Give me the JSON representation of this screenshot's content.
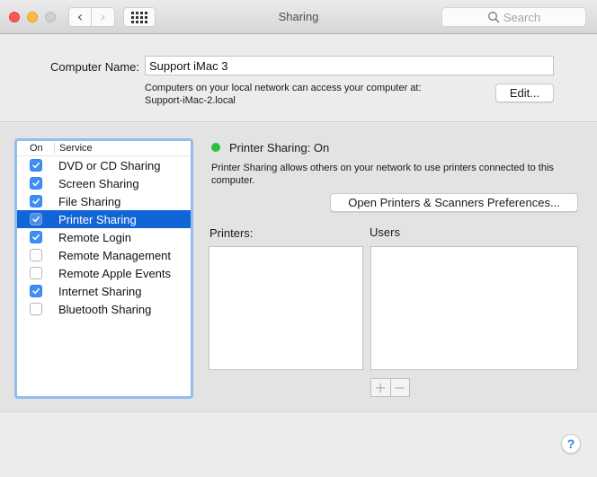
{
  "window": {
    "title": "Sharing",
    "search_placeholder": "Search",
    "colors": {
      "close": "#fc5753",
      "minimize": "#fdbc40",
      "zoom_disabled": "#d0d0d0"
    }
  },
  "toolbar": {
    "back_icon": "chevron-left-icon",
    "forward_icon": "chevron-right-icon",
    "grid_icon": "show-all-grid-icon",
    "back_glyph": "‹",
    "forward_glyph": "›"
  },
  "computer_name": {
    "label": "Computer Name:",
    "value": "Support iMac 3",
    "description_line1": "Computers on your local network can access your computer at:",
    "description_line2": "Support-iMac-2.local",
    "edit_button": "Edit..."
  },
  "services": {
    "header_on": "On",
    "header_service": "Service",
    "selected_index": 3,
    "items": [
      {
        "label": "DVD or CD Sharing",
        "on": true
      },
      {
        "label": "Screen Sharing",
        "on": true
      },
      {
        "label": "File Sharing",
        "on": true
      },
      {
        "label": "Printer Sharing",
        "on": true
      },
      {
        "label": "Remote Login",
        "on": true
      },
      {
        "label": "Remote Management",
        "on": false
      },
      {
        "label": "Remote Apple Events",
        "on": false
      },
      {
        "label": "Internet Sharing",
        "on": true
      },
      {
        "label": "Bluetooth Sharing",
        "on": false
      }
    ]
  },
  "detail": {
    "status_text": "Printer Sharing: On",
    "status_color": "#2dc13f",
    "description": "Printer Sharing allows others on your network to use printers connected to this computer.",
    "open_prefs_button": "Open Printers & Scanners Preferences...",
    "printers_label": "Printers:",
    "users_label": "Users",
    "printers": [],
    "users": [],
    "add_glyph": "+",
    "remove_glyph": "−"
  },
  "help": {
    "glyph": "?"
  },
  "accent_color": "#1265d6"
}
